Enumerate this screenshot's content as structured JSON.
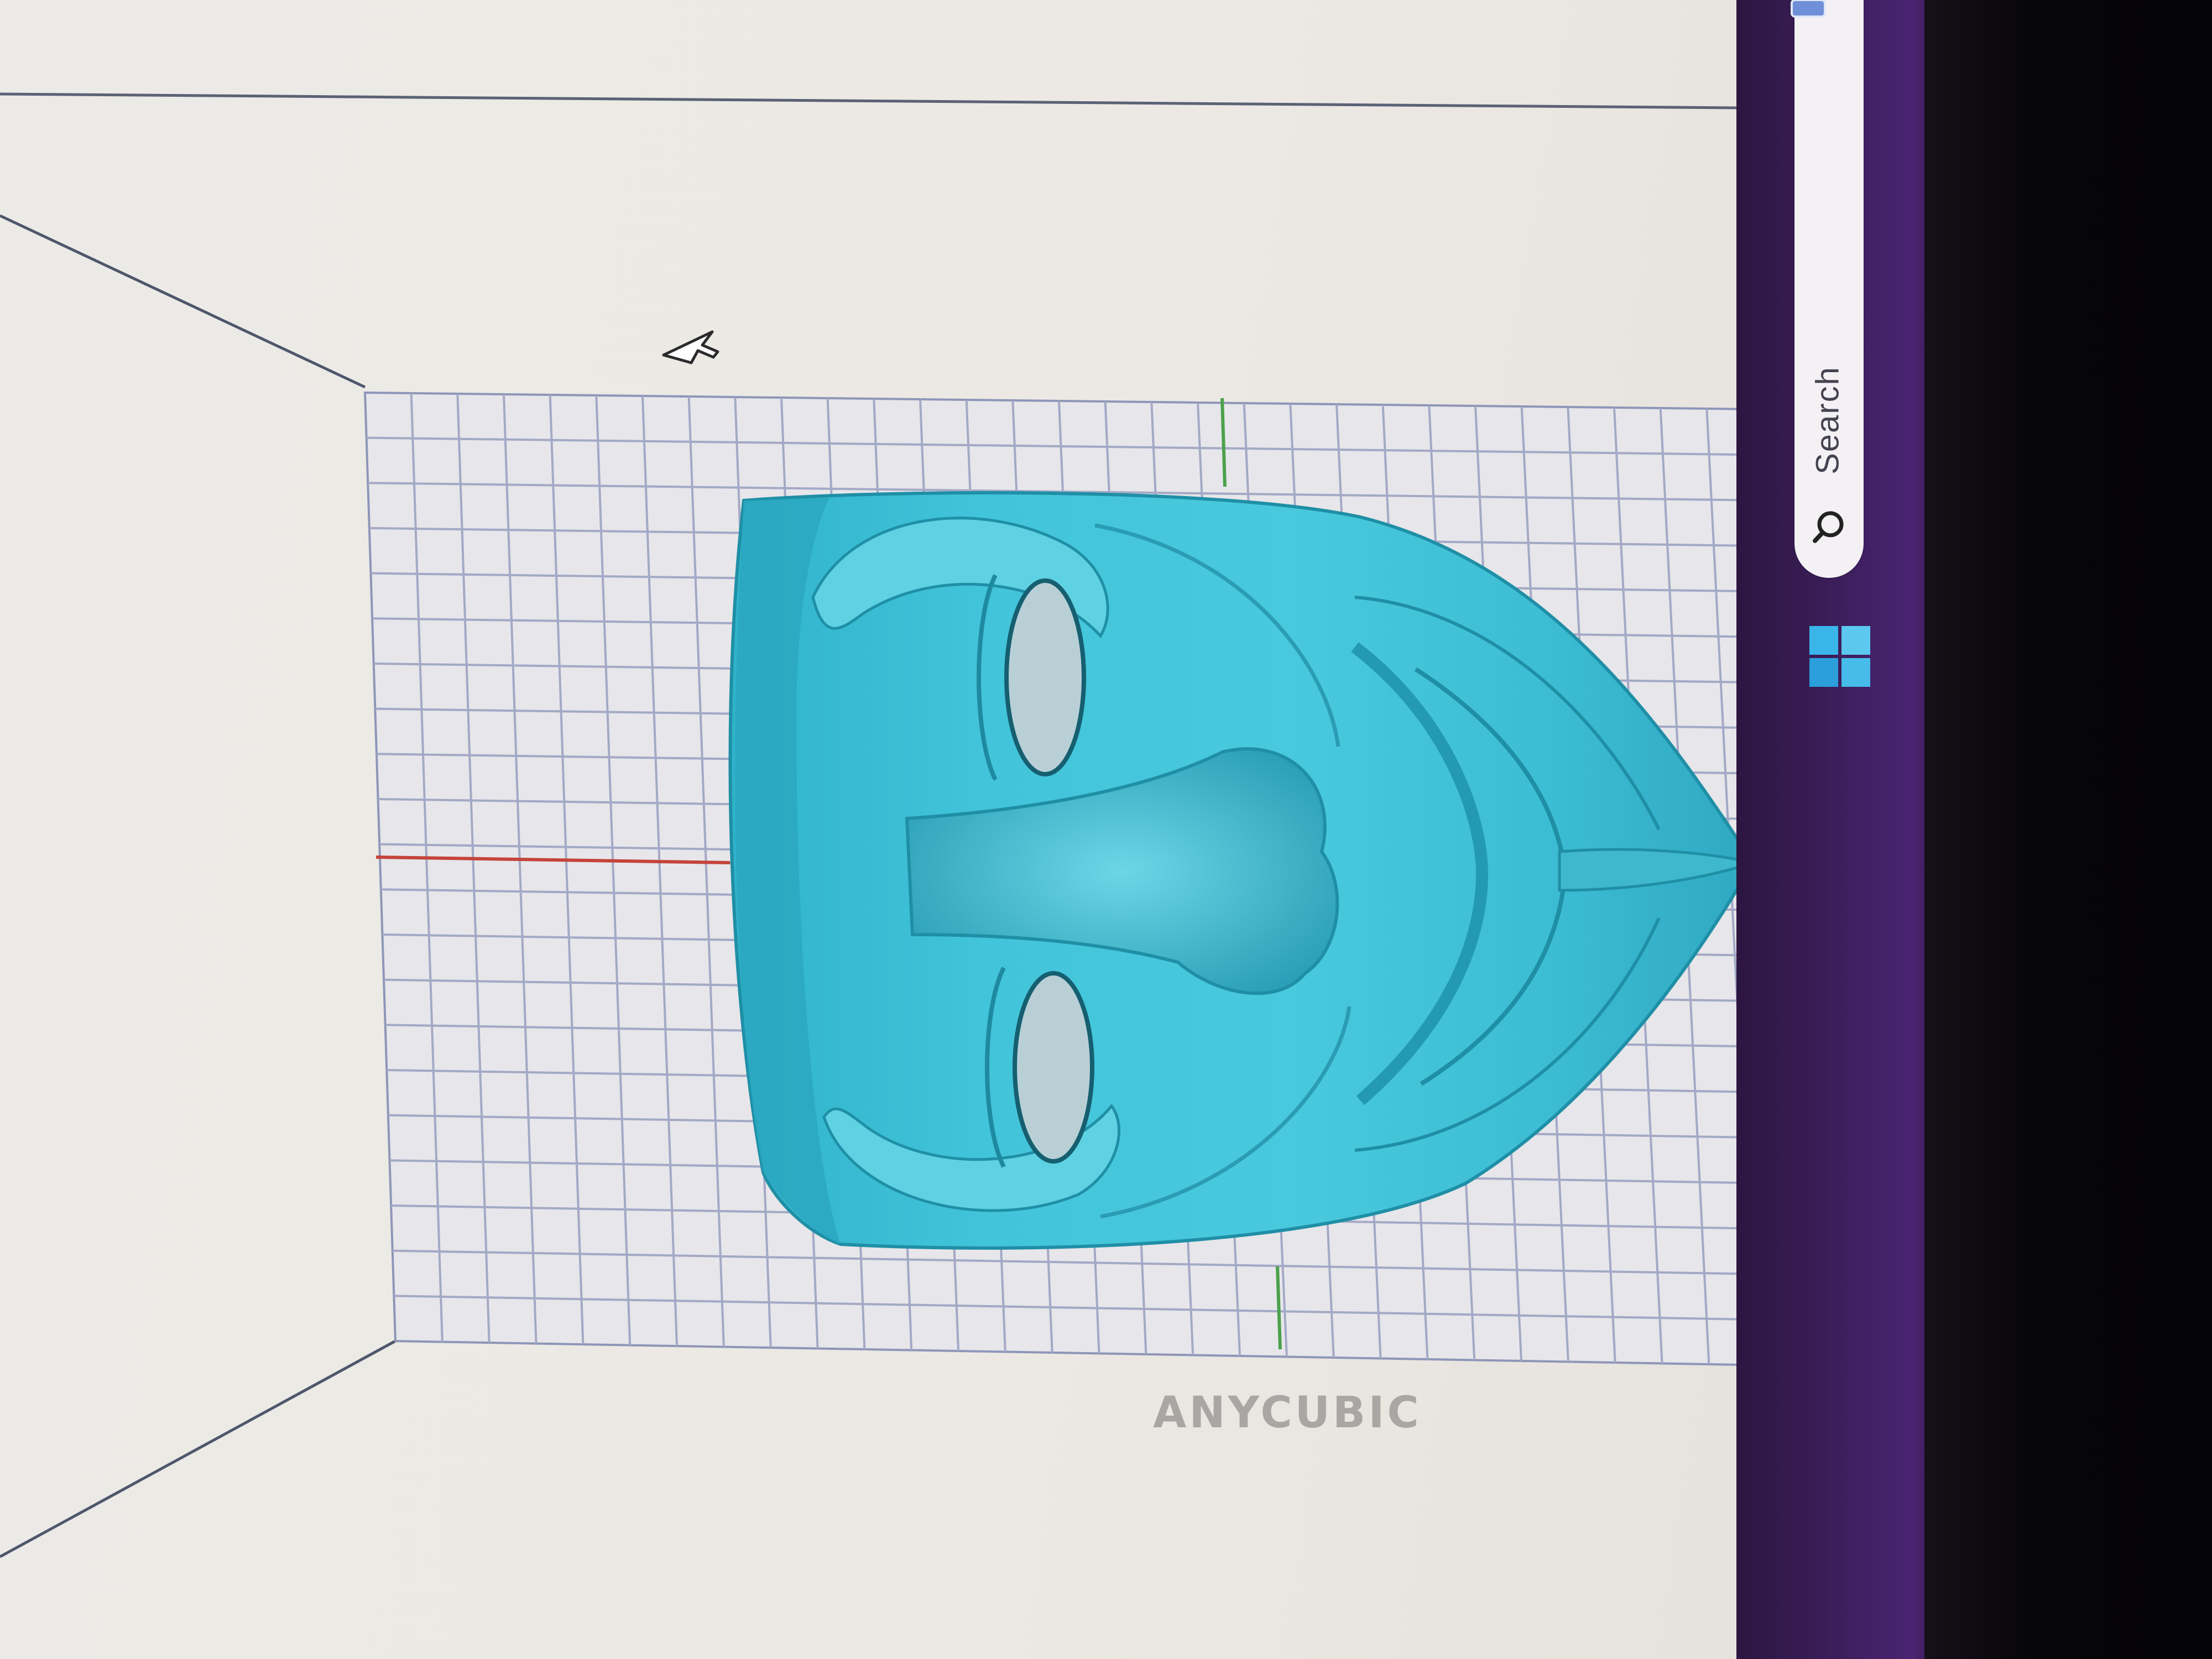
{
  "app": {
    "brand_label": "ANYCUBIC",
    "colors": {
      "model": "#3cc0d6",
      "model_shadow": "#1f8fa6",
      "grid": "#9fa8c8",
      "x_axis": "#d24a3c",
      "y_axis": "#4ab04a",
      "taskbar": "#3a1d58",
      "background": "#ebe8e3"
    }
  },
  "viewport": {
    "model_name": "",
    "model_icon": "face-mask-model",
    "cursor_icon": "arrow-cursor-icon"
  },
  "taskbar": {
    "search_placeholder": "Search",
    "search_icon": "search-icon",
    "start_icon": "windows-start-icon"
  }
}
